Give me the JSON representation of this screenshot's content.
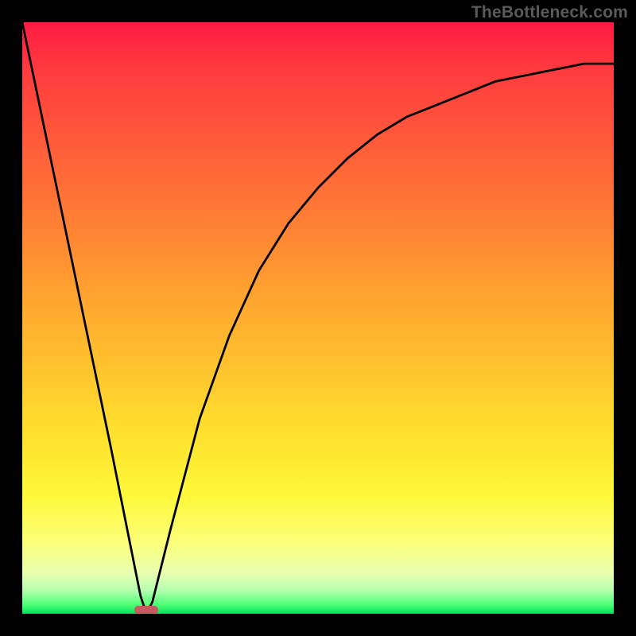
{
  "watermark": "TheBottleneck.com",
  "colors": {
    "frame": "#000000",
    "curve": "#000000",
    "marker": "#c65a5f"
  },
  "chart_data": {
    "type": "line",
    "title": "",
    "xlabel": "",
    "ylabel": "",
    "xlim": [
      0,
      100
    ],
    "ylim": [
      0,
      100
    ],
    "grid": false,
    "legend": false,
    "series": [
      {
        "name": "bottleneck-curve",
        "x": [
          0,
          5,
          10,
          15,
          18,
          20,
          21,
          22,
          25,
          30,
          35,
          40,
          45,
          50,
          55,
          60,
          65,
          70,
          75,
          80,
          85,
          90,
          95,
          100
        ],
        "values": [
          100,
          76,
          52,
          28,
          13,
          3,
          0,
          2,
          14,
          33,
          47,
          58,
          66,
          72,
          77,
          81,
          84,
          86,
          88,
          90,
          91,
          92,
          93,
          93
        ]
      }
    ],
    "marker": {
      "x_start": 19,
      "x_end": 23,
      "y": 0
    }
  }
}
